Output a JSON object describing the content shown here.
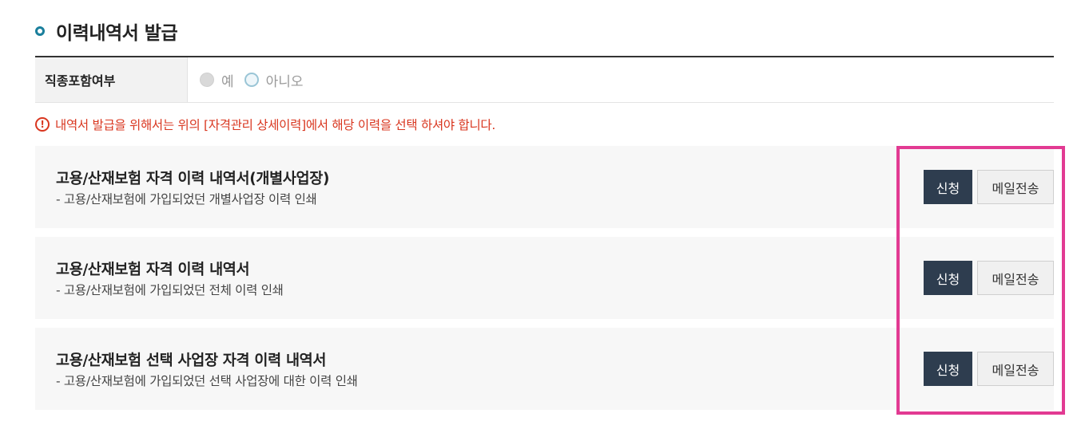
{
  "section": {
    "title": "이력내역서 발급",
    "icon": "circle-bullet-icon",
    "accent_color": "#1a7f9c"
  },
  "option": {
    "label": "직종포함여부",
    "choices": [
      {
        "label": "예",
        "state": "disabled"
      },
      {
        "label": "아니오",
        "state": "unselected"
      }
    ]
  },
  "notice": {
    "icon": "exclamation-circle-icon",
    "text": "내역서 발급을 위해서는 위의 [자격관리 상세이력]에서 해당 이력을 선택 하셔야 합니다.",
    "color": "#d9361f"
  },
  "documents": [
    {
      "title": "고용/산재보험 자격 이력 내역서(개별사업장)",
      "description": "- 고용/산재보험에 가입되었던 개별사업장 이력 인쇄",
      "apply_label": "신청",
      "mail_label": "메일전송"
    },
    {
      "title": "고용/산재보험 자격 이력 내역서",
      "description": "- 고용/산재보험에 가입되었던 전체 이력 인쇄",
      "apply_label": "신청",
      "mail_label": "메일전송"
    },
    {
      "title": "고용/산재보험 선택 사업장 자격 이력 내역서",
      "description": "- 고용/산재보험에 가입되었던 선택 사업장에 대한 이력 인쇄",
      "apply_label": "신청",
      "mail_label": "메일전송"
    }
  ],
  "colors": {
    "apply_button": "#2e3d4f",
    "highlight": "#e23a92"
  }
}
